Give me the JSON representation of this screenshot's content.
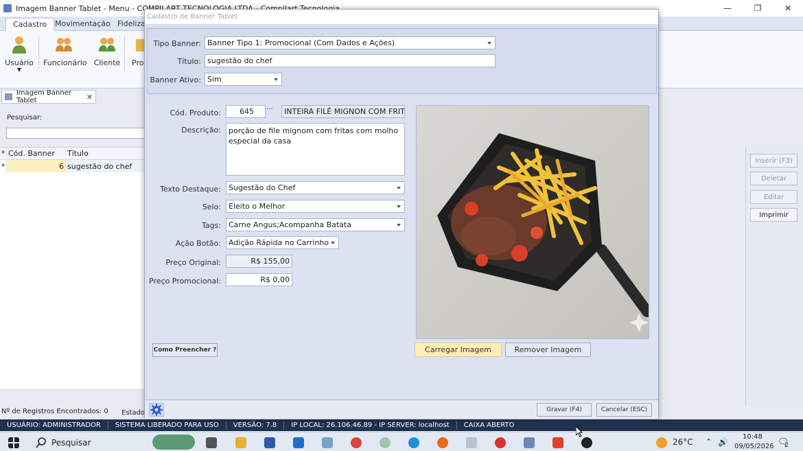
{
  "window": {
    "title": "Imagem Banner Tablet - Menu - COMPILART TECNOLOGIA LTDA - Compilart Tecnologia"
  },
  "ribbon": {
    "tabs": [
      {
        "label": "Cadastro"
      },
      {
        "label": "Movimentação"
      },
      {
        "label": "Fideliza"
      }
    ],
    "buttons": [
      {
        "label": "Usuário"
      },
      {
        "label": "Funcionário"
      },
      {
        "label": "Cliente"
      },
      {
        "label": "Pro"
      }
    ]
  },
  "doc_tab": {
    "label": "Imagem Banner Tablet"
  },
  "list": {
    "search_label": "Pesquisar:",
    "columns": [
      "*",
      "Cód. Banner",
      "Título"
    ],
    "rows": [
      {
        "marker": "*",
        "code": "6",
        "title": "sugestão do chef"
      }
    ],
    "records": "Nº de Registros Encontrados: 0",
    "state_label": "Estado:"
  },
  "side_buttons": {
    "insert": "Inserir (F3)",
    "delete": "Deletar",
    "edit": "Editar",
    "print": "Imprimir"
  },
  "dialog": {
    "title": "Cadastro de Banner Tablet",
    "labels": {
      "tipo": "Tipo Banner:",
      "titulo": "Título:",
      "ativo": "Banner Ativo:",
      "cod_produto": "Cód. Produto:",
      "descricao": "Descrição:",
      "texto_destaque": "Texto Destaque:",
      "selo": "Selo:",
      "tags": "Tags:",
      "acao": "Ação Botão:",
      "preco_original": "Preço Original:",
      "preco_promocional": "Preço Promocional:"
    },
    "values": {
      "tipo": "Banner Tipo 1: Promocional (Com Dados e Ações)",
      "titulo": "sugestão do chef",
      "ativo": "Sim",
      "cod_produto": "645",
      "produto_nome": "INTEIRA FILÉ MIGNON COM FRITAS",
      "descricao": "porção de file mignom com fritas com molho especial da casa",
      "texto_destaque": "Sugestão do Chef",
      "selo": "Eleito o Melhor",
      "tags": "Carne Angus;Acompanha Batata",
      "acao": "Adição Rápida no Carrinho",
      "preco_original": "R$ 155,00",
      "preco_promocional": "R$ 0,00"
    },
    "buttons": {
      "ellipsis": "···",
      "como_preencher": "Como Preencher ?",
      "carregar": "Carregar Imagem",
      "remover": "Remover Imagem",
      "gravar": "Gravar (F4)",
      "cancelar": "Cancelar (ESC)"
    }
  },
  "statusbar": [
    "USUÁRIO: ADMINISTRADOR",
    "SISTEMA LIBERADO PARA USO",
    "VERSÃO: 7.8",
    "IP LOCAL: 26.106.46.89 - IP SERVER: localhost",
    "CAIXA ABERTO"
  ],
  "taskbar": {
    "search": "Pesquisar",
    "weather": "26°C",
    "time": "10:48",
    "date": "09/05/2026",
    "notifications": "2"
  },
  "colors": {
    "statusbar": "#20304f",
    "highlight": "#fdf0bf",
    "dialog_bg": "#d9dff0"
  }
}
